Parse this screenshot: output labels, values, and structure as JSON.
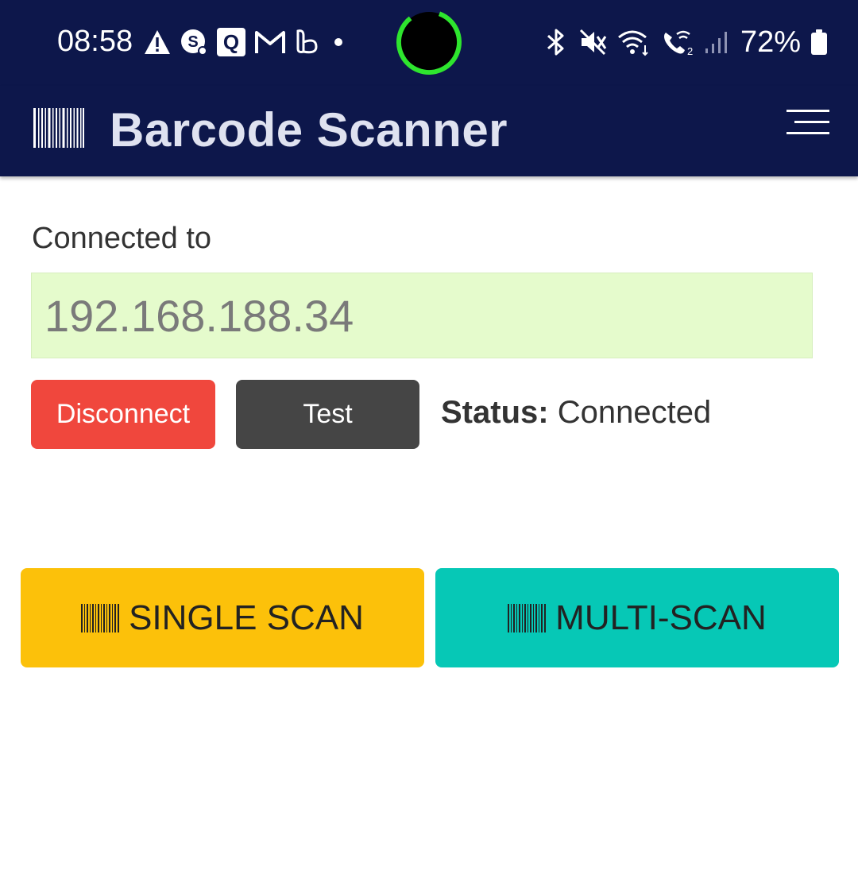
{
  "status_bar": {
    "time": "08:58",
    "notification_icons": [
      "warning-icon",
      "app-s-icon",
      "app-q-icon",
      "gmail-icon",
      "app-b-icon",
      "dot-icon"
    ],
    "system_icons": [
      "bluetooth-icon",
      "vibrate-mute-icon",
      "wifi-icon",
      "wifi-calling-icon",
      "signal-icon",
      "battery-icon"
    ],
    "battery_percent": "72%"
  },
  "app_bar": {
    "title": "Barcode Scanner",
    "logo_icon": "barcode-icon",
    "menu_icon": "hamburger-menu-icon"
  },
  "connection": {
    "label": "Connected to",
    "ip_value": "192.168.188.34",
    "disconnect_label": "Disconnect",
    "test_label": "Test",
    "status_label": "Status:",
    "status_value": "Connected"
  },
  "scan": {
    "single_label": "SINGLE SCAN",
    "multi_label": "MULTI-SCAN"
  },
  "colors": {
    "header_bg": "#0d174b",
    "ip_field_bg": "#e5fbcc",
    "disconnect_bg": "#f0473d",
    "test_bg": "#454545",
    "single_scan_bg": "#fcc10a",
    "multi_scan_bg": "#06c8b6",
    "camera_ring": "#2ee52e"
  }
}
